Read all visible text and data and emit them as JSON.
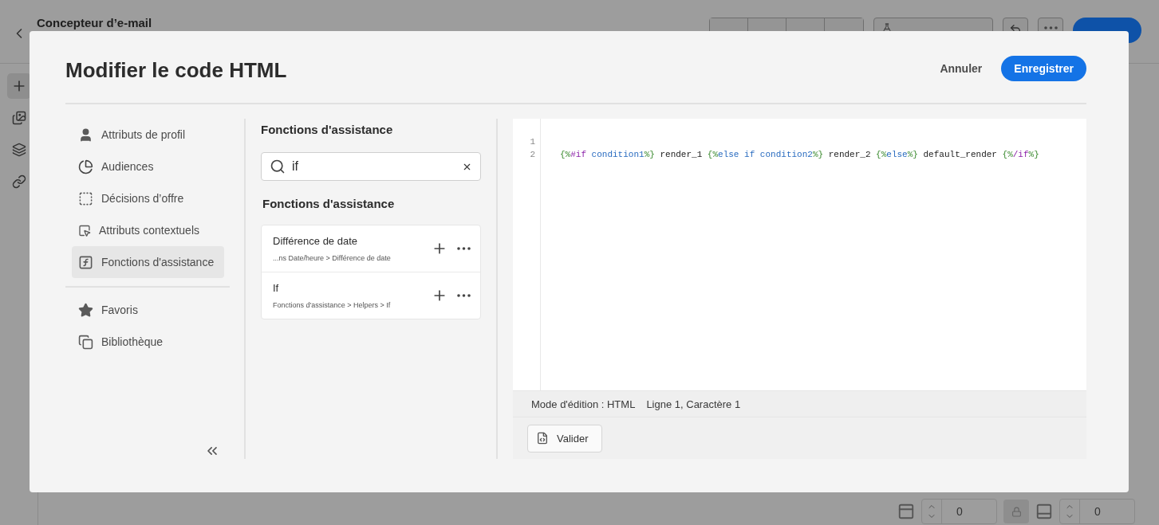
{
  "app": {
    "title": "Concepteur d’e-mail",
    "rail": [
      {
        "kind": "add",
        "selected": true
      },
      {
        "kind": "media",
        "selected": false
      },
      {
        "kind": "layers",
        "selected": false
      },
      {
        "kind": "link",
        "selected": false
      }
    ],
    "bottom_fields": [
      "0",
      "0"
    ]
  },
  "dialog": {
    "title": "Modifier le code HTML",
    "cancel": "Annuler",
    "save": "Enregistrer",
    "nav": {
      "items": [
        {
          "kind": "profile",
          "label": "Attributs de profil",
          "selected": false
        },
        {
          "kind": "audience",
          "label": "Audiences",
          "selected": false
        },
        {
          "kind": "offer",
          "label": "Décisions d’offre",
          "selected": false
        },
        {
          "kind": "context",
          "label": "Attributs contextuels",
          "selected": false
        },
        {
          "kind": "function",
          "label": "Fonctions d'assistance",
          "selected": true
        }
      ],
      "pinned": [
        {
          "kind": "favorite",
          "label": "Favoris",
          "selected": false
        },
        {
          "kind": "library",
          "label": "Bibliothèque",
          "selected": false
        }
      ]
    },
    "helpers": {
      "heading": "Fonctions d'assistance",
      "search": {
        "value": "if"
      },
      "results_heading": "Fonctions d'assistance",
      "results": [
        {
          "name": "Différence de date",
          "path": "...ns Date/heure > Différence de date"
        },
        {
          "name": "If",
          "path": "Fonctions d'assistance > Helpers > If"
        }
      ]
    },
    "editor": {
      "lines": [
        {
          "number": "1"
        },
        {
          "number": "2",
          "tokens": [
            {
              "kind": "delim",
              "text": "{%"
            },
            {
              "kind": "keyword",
              "text": "#if"
            },
            {
              "kind": "expr",
              "text": " condition1"
            },
            {
              "kind": "delim",
              "text": "%}"
            },
            {
              "kind": "text",
              "text": " render_1 "
            },
            {
              "kind": "delim",
              "text": "{%"
            },
            {
              "kind": "expr",
              "text": "else if condition2"
            },
            {
              "kind": "delim",
              "text": "%}"
            },
            {
              "kind": "text",
              "text": " render_2 "
            },
            {
              "kind": "delim",
              "text": "{%"
            },
            {
              "kind": "expr",
              "text": "else"
            },
            {
              "kind": "delim",
              "text": "%}"
            },
            {
              "kind": "text",
              "text": " default_render "
            },
            {
              "kind": "delim",
              "text": "{%"
            },
            {
              "kind": "keyword",
              "text": "/if"
            },
            {
              "kind": "delim",
              "text": "%}"
            }
          ]
        }
      ],
      "status": {
        "mode": "Mode d'édition : HTML",
        "position": "Ligne 1, Caractère 1"
      },
      "validate": "Valider"
    }
  }
}
